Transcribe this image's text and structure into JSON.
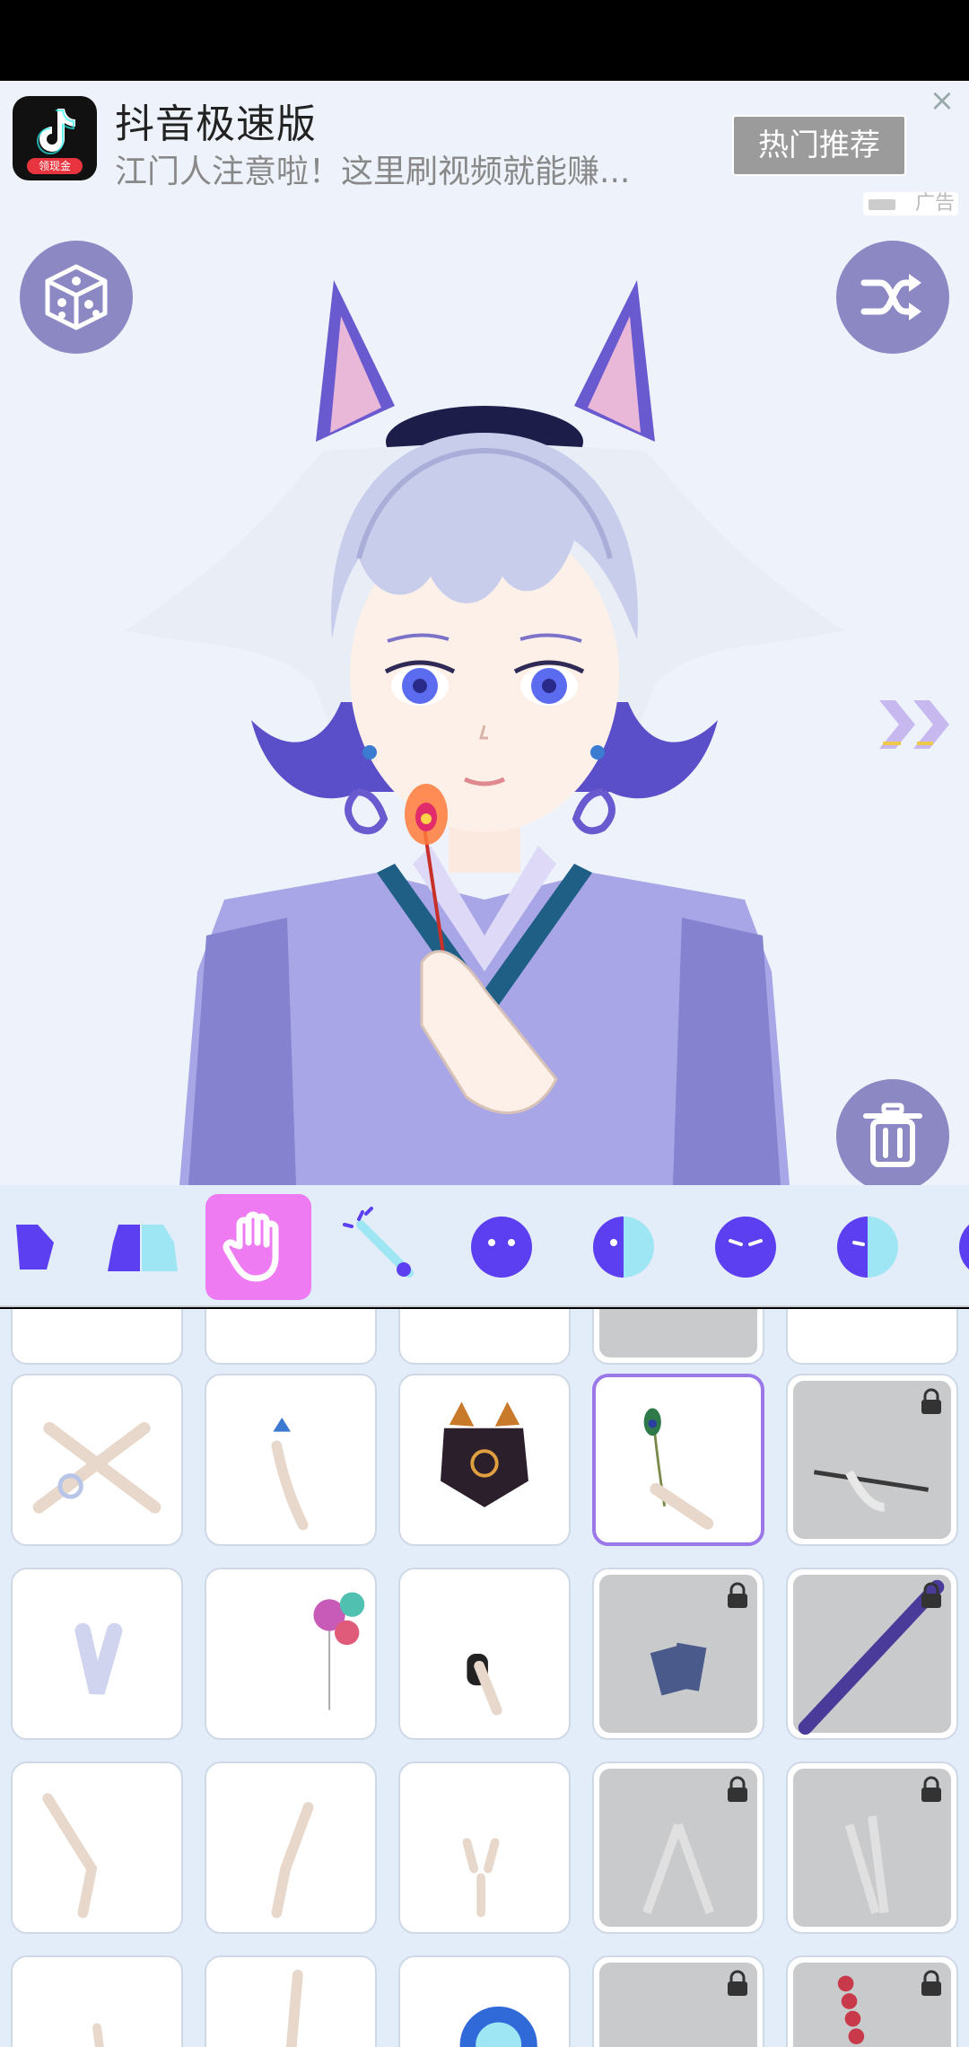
{
  "ad": {
    "app_name": "抖音极速版",
    "subtitle": "江门人注意啦！这里刷视频就能赚...",
    "logo_badge": "领现金",
    "button_label": "热门推荐",
    "close_glyph": "×",
    "tag_label": "广告"
  },
  "stage": {
    "left_button_icon": "dice-icon",
    "right_button_icon": "shuffle-icon",
    "next_icon": "double-chevron-right-icon",
    "delete_icon": "trash-icon"
  },
  "categories": [
    {
      "icon": "top-clothing-icon",
      "active": false
    },
    {
      "icon": "outfit-icon",
      "active": false
    },
    {
      "icon": "hand-icon",
      "active": true
    },
    {
      "icon": "wand-accessory-icon",
      "active": false
    },
    {
      "icon": "face-icon",
      "active": false
    },
    {
      "icon": "half-face-icon",
      "active": false
    },
    {
      "icon": "expression-icon",
      "active": false
    },
    {
      "icon": "half-expression-icon",
      "active": false
    }
  ],
  "items_grid": {
    "rows": [
      [
        "crossed-hands",
        "hand-with-bird",
        "hands-holding-mask",
        "hand-with-peacock-feather",
        "hand-with-pipe"
      ],
      [
        "gloved-hand",
        "hand-with-balloons",
        "hand-holding-object",
        "hand-with-cards",
        "hand-with-guitar"
      ],
      [
        "raised-hand",
        "pointing-hand",
        "peace-sign-hand",
        "praying-hands",
        "open-hand"
      ],
      [
        "hand-partial",
        "finger-pointing-up",
        "hand-with-crystal-ball",
        "hand-partial-locked",
        "hand-with-beads"
      ]
    ],
    "selected": "hand-with-peacock-feather",
    "locked": [
      "hand-with-pipe",
      "hand-with-cards",
      "hand-with-guitar",
      "praying-hands",
      "open-hand",
      "hand-partial-locked",
      "hand-with-beads"
    ]
  },
  "colors": {
    "accent_purple": "#8b88c4",
    "active_tab": "#ee7bf2",
    "icon_blue": "#5b3ff0",
    "selected_border": "#9b78e8",
    "background": "#eef3fb"
  }
}
